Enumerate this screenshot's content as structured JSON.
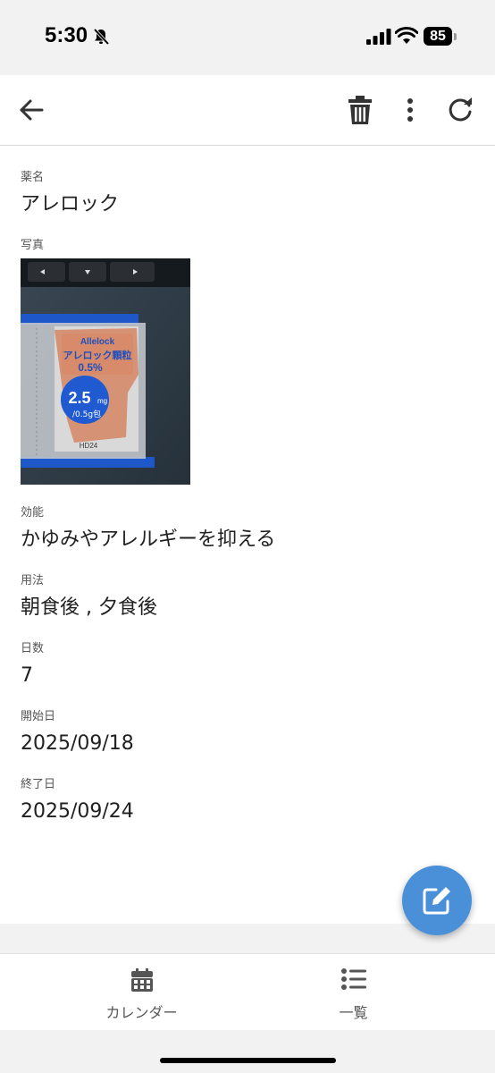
{
  "status_bar": {
    "time": "5:30",
    "battery": "85"
  },
  "app_bar": {
    "back_icon": "arrow-left-icon",
    "delete_icon": "trash-icon",
    "more_icon": "more-vertical-icon",
    "refresh_icon": "refresh-icon"
  },
  "medicine": {
    "name_label": "薬名",
    "name_value": "アレロック",
    "photo_label": "写真",
    "photo_text": {
      "brand": "Allelock",
      "name": "アレロック顆粒",
      "percent": "0.5%",
      "dose": "2.5",
      "unit": "mg",
      "per": "/0.5g包",
      "lot": "HD24"
    },
    "effect_label": "効能",
    "effect_value": "かゆみやアレルギーを抑える",
    "usage_label": "用法",
    "usage_value": "朝食後 , 夕食後",
    "days_label": "日数",
    "days_value": "7",
    "start_label": "開始日",
    "start_value": "2025/09/18",
    "end_label": "終了日",
    "end_value": "2025/09/24"
  },
  "fab": {
    "icon": "edit-icon",
    "color": "#4a90d9"
  },
  "bottom_nav": {
    "calendar_label": "カレンダー",
    "list_label": "一覧"
  }
}
